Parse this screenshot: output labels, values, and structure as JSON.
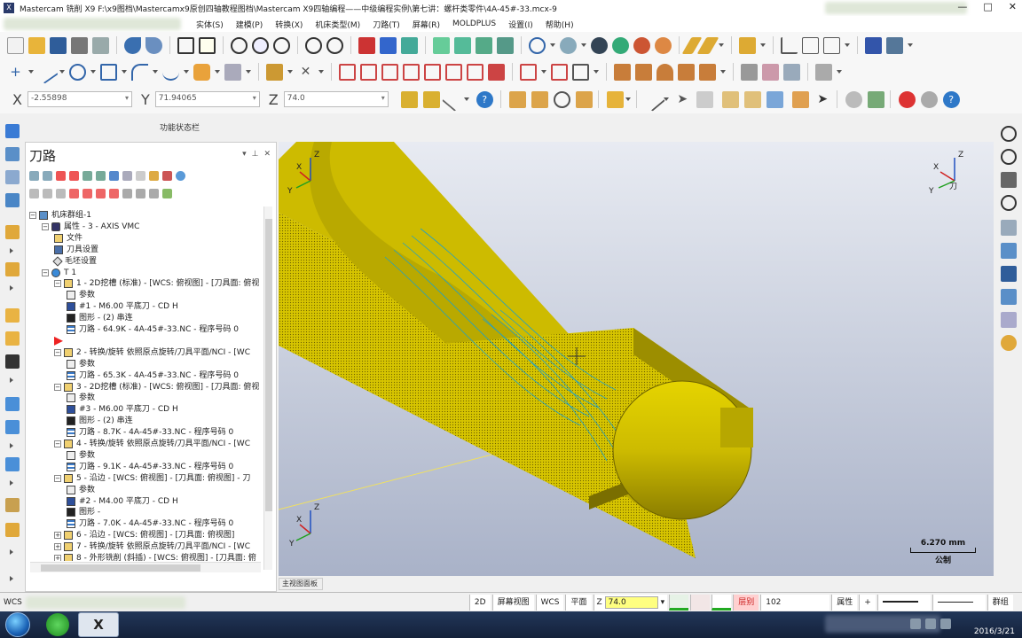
{
  "window": {
    "title": "Mastercam 铣削 X9  F:\\x9图档\\Mastercamx9原创四轴教程图档\\Mastercam X9四轴编程——中级编程实例\\第七讲：螺杆类零件\\4A-45#-33.mcx-9",
    "app_icon": "X",
    "min": "—",
    "max": "□",
    "close": "✕"
  },
  "menu": {
    "items": [
      "实体(S)",
      "建模(P)",
      "转换(X)",
      "机床类型(M)",
      "刀路(T)",
      "屏幕(R)",
      "MOLDPLUS",
      "设置(I)",
      "帮助(H)"
    ]
  },
  "coords": {
    "x_label": "X",
    "x_value": "-2.55898",
    "y_label": "Y",
    "y_value": "71.94065",
    "z_label": "Z",
    "z_value": "74.0"
  },
  "function_status": "功能状态栏",
  "panel": {
    "title": "刀路",
    "ctrl_dropdown": "▾",
    "ctrl_pin": "⊥",
    "ctrl_close": "✕"
  },
  "tree": [
    {
      "text": "机床群组-1",
      "level": 0,
      "icon": "machine-group-icon",
      "exp": "−"
    },
    {
      "text": "属性 - 3 - AXIS VMC",
      "level": 1,
      "icon": "properties-icon",
      "exp": "−"
    },
    {
      "text": "文件",
      "level": 2,
      "icon": "folder-icon",
      "exp": ""
    },
    {
      "text": "刀具设置",
      "level": 2,
      "icon": "tool-settings-icon",
      "exp": ""
    },
    {
      "text": "毛坯设置",
      "level": 2,
      "icon": "stock-settings-icon",
      "exp": ""
    },
    {
      "text": "T 1",
      "level": 1,
      "icon": "toolpath-group-icon",
      "exp": "−"
    },
    {
      "text": "1 - 2D挖槽 (标准) - [WCS: 俯视图] - [刀具面: 俯视",
      "level": 2,
      "icon": "operation-folder-icon",
      "exp": "−"
    },
    {
      "text": "参数",
      "level": 3,
      "icon": "params-icon",
      "exp": ""
    },
    {
      "text": "#1 - M6.00 平底刀 - CD  H",
      "level": 3,
      "icon": "tool-icon",
      "exp": ""
    },
    {
      "text": "图形 - (2) 串连",
      "level": 3,
      "icon": "geometry-icon",
      "exp": ""
    },
    {
      "text": "刀路 - 64.9K - 4A-45#-33.NC - 程序号码 0",
      "level": 3,
      "icon": "toolpath-icon",
      "exp": ""
    },
    {
      "text": "",
      "level": 2,
      "icon": "insert-arrow-icon",
      "exp": ""
    },
    {
      "text": "2 - 转换/旋转 依照原点旋转/刀具平面/NCI - [WC",
      "level": 2,
      "icon": "operation-folder-icon",
      "exp": "−"
    },
    {
      "text": "参数",
      "level": 3,
      "icon": "params-icon",
      "exp": ""
    },
    {
      "text": "刀路 - 65.3K - 4A-45#-33.NC - 程序号码 0",
      "level": 3,
      "icon": "toolpath-icon",
      "exp": ""
    },
    {
      "text": "3 - 2D挖槽 (标准) - [WCS: 俯视图] - [刀具面: 俯视",
      "level": 2,
      "icon": "operation-folder-icon",
      "exp": "−"
    },
    {
      "text": "参数",
      "level": 3,
      "icon": "params-icon",
      "exp": ""
    },
    {
      "text": "#3 - M6.00 平底刀 - CD  H",
      "level": 3,
      "icon": "tool-icon",
      "exp": ""
    },
    {
      "text": "图形 - (2) 串连",
      "level": 3,
      "icon": "geometry-icon",
      "exp": ""
    },
    {
      "text": "刀路 - 8.7K - 4A-45#-33.NC - 程序号码 0",
      "level": 3,
      "icon": "toolpath-icon",
      "exp": ""
    },
    {
      "text": "4 - 转换/旋转 依照原点旋转/刀具平面/NCI - [WC",
      "level": 2,
      "icon": "operation-folder-icon",
      "exp": "−"
    },
    {
      "text": "参数",
      "level": 3,
      "icon": "params-icon",
      "exp": ""
    },
    {
      "text": "刀路 - 9.1K - 4A-45#-33.NC - 程序号码 0",
      "level": 3,
      "icon": "toolpath-icon",
      "exp": ""
    },
    {
      "text": "5 - 沿边 - [WCS: 俯视图] - [刀具面: 俯视图] - 刀",
      "level": 2,
      "icon": "operation-folder-icon",
      "exp": "−"
    },
    {
      "text": "参数",
      "level": 3,
      "icon": "params-icon",
      "exp": ""
    },
    {
      "text": "#2 - M4.00 平底刀 - CD  H",
      "level": 3,
      "icon": "tool-icon",
      "exp": ""
    },
    {
      "text": "图形 -",
      "level": 3,
      "icon": "geometry-icon",
      "exp": ""
    },
    {
      "text": "刀路 - 7.0K - 4A-45#-33.NC - 程序号码 0",
      "level": 3,
      "icon": "toolpath-icon",
      "exp": ""
    },
    {
      "text": "6 - 沿边 - [WCS: 俯视图] - [刀具面: 俯视图]",
      "level": 2,
      "icon": "operation-folder-icon",
      "exp": "+"
    },
    {
      "text": "7 - 转换/旋转 依照原点旋转/刀具平面/NCI - [WC",
      "level": 2,
      "icon": "operation-folder-icon",
      "exp": "+"
    },
    {
      "text": "8 - 外形铣削 (斜插) - [WCS: 俯视图] - [刀具面: 俯",
      "level": 2,
      "icon": "operation-folder-icon",
      "exp": "+"
    },
    {
      "text": "9 - 外形铣削 (2D) - [WCS: 俯视图] - [刀具面: 俯视",
      "level": 2,
      "icon": "operation-folder-icon",
      "exp": "+"
    }
  ],
  "viewport": {
    "tab_label": "主视图面板",
    "scale_value": "6.270 mm",
    "scale_unit": "公制",
    "axis_z": "Z",
    "axis_x": "X",
    "axis_y": "Y",
    "axis_tool": "刀"
  },
  "statusbar": {
    "mode_2d": "2D",
    "screen_view": "屏幕视图",
    "wcs": "WCS",
    "plane": "平面",
    "z_label": "Z",
    "z_value": "74.0",
    "level_label": "层别",
    "level_value": "102",
    "attributes": "属性",
    "plus": "+",
    "group": "群组",
    "wcs_left": "WCS"
  },
  "taskbar": {
    "date": "2016/3/21",
    "mastercam_label": "X"
  },
  "colors": {
    "part_yellow": "#d6c400",
    "part_dark": "#8a7d00",
    "toolpath_cyan": "#1ea0c8",
    "viewport_top": "#e8ebf2",
    "viewport_bottom": "#a9b2c8"
  }
}
